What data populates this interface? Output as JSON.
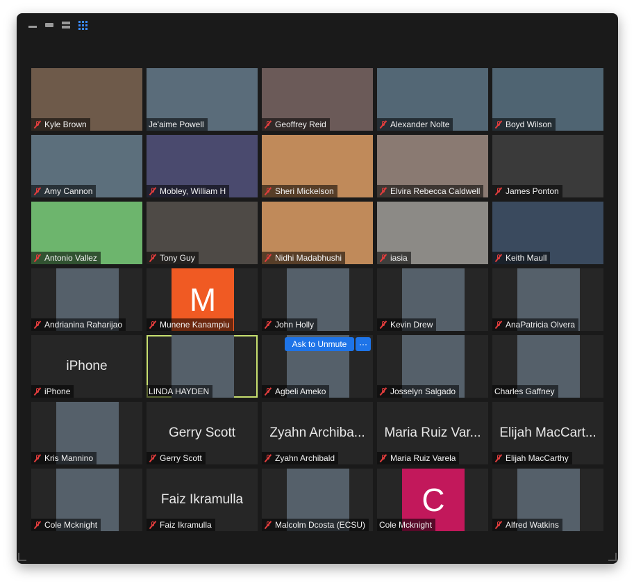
{
  "window": {
    "title": "",
    "view_controls": [
      "minimize-view",
      "single-view",
      "split-view",
      "gallery-view"
    ]
  },
  "participants": [
    {
      "name": "Kyle Brown",
      "muted": true,
      "bg": "#6e5a4a"
    },
    {
      "name": "Je'aime Powell",
      "muted": false,
      "bg": "#5a6c7a"
    },
    {
      "name": "Geoffrey Reid",
      "muted": true,
      "bg": "#6b5a58"
    },
    {
      "name": "Alexander Nolte",
      "muted": true,
      "bg": "#536775"
    },
    {
      "name": "Boyd Wilson",
      "muted": true,
      "bg": "#4f6472"
    },
    {
      "name": "Amy Cannon",
      "muted": true,
      "bg": "#5c6f7c"
    },
    {
      "name": "Mobley, William H",
      "muted": true,
      "bg": "#4a4a6e"
    },
    {
      "name": "Sheri Mickelson",
      "muted": true,
      "bg": "#c08a5a"
    },
    {
      "name": "Elvira Rebecca Caldwell",
      "muted": true,
      "bg": "#8a7a72"
    },
    {
      "name": "James Ponton",
      "muted": true,
      "bg": "#3a3a3a"
    },
    {
      "name": "Antonio Vallez",
      "muted": true,
      "bg": "#6db56d"
    },
    {
      "name": "Tony Guy",
      "muted": true,
      "bg": "#4e4a46"
    },
    {
      "name": "Nidhi Madabhushi",
      "muted": true,
      "bg": "#c08a5a"
    },
    {
      "name": "iasia",
      "muted": true,
      "bg": "#8c8a86"
    },
    {
      "name": "Keith Maull",
      "muted": true,
      "bg": "#3a4a5e"
    },
    {
      "name": "Andrianina Raharijao",
      "muted": true,
      "bg": "#262626"
    },
    {
      "name": "Munene Kanampiu",
      "muted": true,
      "bg": "#262626",
      "avatar": "M",
      "avatar_color": "#f05a23"
    },
    {
      "name": "John Holly",
      "muted": true,
      "bg": "#262626"
    },
    {
      "name": "Kevin Drew",
      "muted": true,
      "bg": "#262626"
    },
    {
      "name": "AnaPatricia Olvera",
      "muted": true,
      "bg": "#262626"
    },
    {
      "name": "iPhone",
      "muted": true,
      "bg": "#262626",
      "big": "iPhone"
    },
    {
      "name": "LINDA HAYDEN",
      "muted": false,
      "bg": "#262626",
      "highlight": true
    },
    {
      "name": "Agbeli Ameko",
      "muted": true,
      "bg": "#262626"
    },
    {
      "name": "Josselyn Salgado",
      "muted": true,
      "bg": "#262626"
    },
    {
      "name": "Charles Gaffney",
      "muted": false,
      "bg": "#262626"
    },
    {
      "name": "Kris Mannino",
      "muted": true,
      "bg": "#262626"
    },
    {
      "name": "Gerry Scott",
      "muted": true,
      "bg": "#262626",
      "big": "Gerry Scott"
    },
    {
      "name": "Zyahn Archibald",
      "muted": true,
      "bg": "#262626",
      "big": "Zyahn Archiba..."
    },
    {
      "name": "Maria Ruiz Varela",
      "muted": true,
      "bg": "#262626",
      "big": "Maria Ruiz Var..."
    },
    {
      "name": "Elijah MacCarthy",
      "muted": true,
      "bg": "#262626",
      "big": "Elijah MacCart..."
    },
    {
      "name": "Cole Mcknight",
      "muted": true,
      "bg": "#262626"
    },
    {
      "name": "Faiz Ikramulla",
      "muted": true,
      "bg": "#262626",
      "big": "Faiz Ikramulla"
    },
    {
      "name": "Malcolm Dcosta (ECSU)",
      "muted": true,
      "bg": "#262626"
    },
    {
      "name": "Cole Mcknight",
      "muted": false,
      "bg": "#262626",
      "avatar": "C",
      "avatar_color": "#c2185b"
    },
    {
      "name": "Alfred Watkins",
      "muted": true,
      "bg": "#262626"
    }
  ],
  "actions": {
    "ask_to_unmute": "Ask to Unmute",
    "more": "···"
  },
  "colors": {
    "accent": "#1e74e8",
    "highlight": "#c7df6f",
    "muted_icon": "#e23d3d"
  }
}
